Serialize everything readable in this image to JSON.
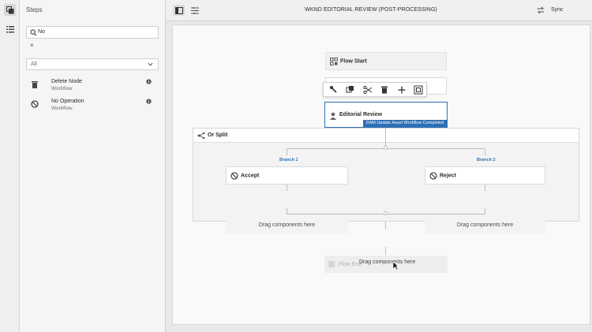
{
  "rail": {
    "icons": [
      "copy-icon",
      "list-icon"
    ]
  },
  "steps_panel": {
    "title": "Steps",
    "search_value": "No",
    "clear_label": "×",
    "filter_value": "All",
    "items": [
      {
        "name": "Delete Node",
        "group": "Workflow",
        "icon": "trash-icon"
      },
      {
        "name": "No Operation",
        "group": "Workflow",
        "icon": "no-entry-icon"
      }
    ]
  },
  "topbar": {
    "title": "WKND EDITORIAL REVIEW (POST-PROCESSING)",
    "sync_label": "Sync"
  },
  "canvas": {
    "flow_start": "Flow Start",
    "editorial_review": "Editorial Review",
    "badge": "DAM Update Asset Workflow Completed",
    "or_split": "Or Split",
    "branch1_label": "Branch 1",
    "branch2_label": "Branch 2",
    "accept": "Accept",
    "reject": "Reject",
    "drag_hint": "Drag components here",
    "ghost_label": "Flow End",
    "drag_overlay": "Drag components here"
  },
  "toolbar_icons": [
    "wrench-icon",
    "copy-icon",
    "cut-icon",
    "trash-icon",
    "plus-icon",
    "group-icon"
  ],
  "colors": {
    "accent": "#2d6fb5"
  }
}
